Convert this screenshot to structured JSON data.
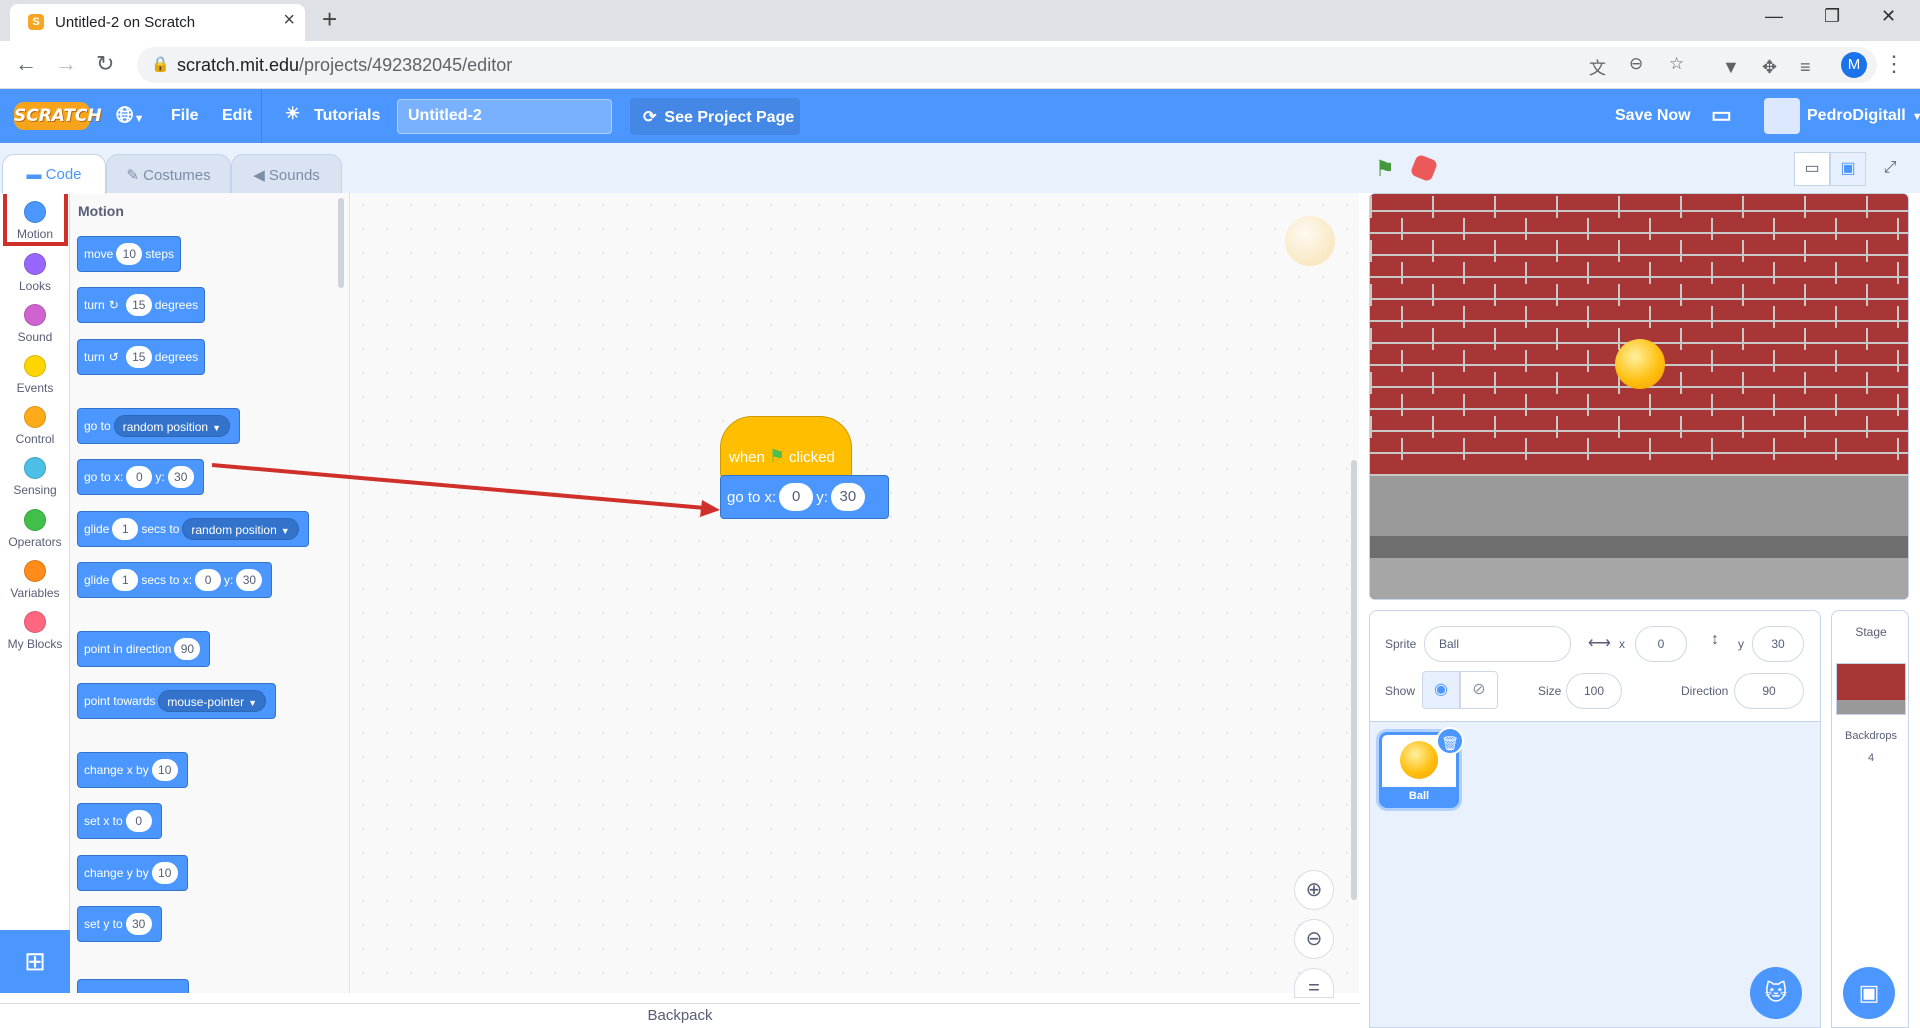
{
  "browser": {
    "tab_title": "Untitled-2 on Scratch",
    "tab_icon": "scratch-favicon",
    "url_host": "scratch.mit.edu",
    "url_path": "/projects/492382045/editor",
    "profile_initial": "M"
  },
  "menu": {
    "logo": "SCRATCH",
    "file": "File",
    "edit": "Edit",
    "tutorials": "Tutorials",
    "project_title": "Untitled-2",
    "see_project_page": "See Project Page",
    "save_now": "Save Now",
    "username": "PedroDigitall"
  },
  "editor_tabs": [
    "Code",
    "Costumes",
    "Sounds"
  ],
  "categories": [
    {
      "label": "Motion",
      "color": "#4c97ff"
    },
    {
      "label": "Looks",
      "color": "#9966ff"
    },
    {
      "label": "Sound",
      "color": "#cf63cf"
    },
    {
      "label": "Events",
      "color": "#ffd500"
    },
    {
      "label": "Control",
      "color": "#ffab19"
    },
    {
      "label": "Sensing",
      "color": "#4cbfe6"
    },
    {
      "label": "Operators",
      "color": "#40bf4a"
    },
    {
      "label": "Variables",
      "color": "#ff8c1a"
    },
    {
      "label": "My Blocks",
      "color": "#ff6680"
    }
  ],
  "palette": {
    "heading": "Motion",
    "blocks": {
      "move": {
        "a": "move",
        "v": "10",
        "b": "steps"
      },
      "turn_right": {
        "a": "turn",
        "v": "15",
        "b": "degrees"
      },
      "turn_left": {
        "a": "turn",
        "v": "15",
        "b": "degrees"
      },
      "goto": {
        "a": "go to",
        "d": "random position"
      },
      "goto_xy": {
        "a": "go to x:",
        "x": "0",
        "b": "y:",
        "y": "30"
      },
      "glide": {
        "a": "glide",
        "v": "1",
        "b": "secs to",
        "d": "random position"
      },
      "glide_xy": {
        "a": "glide",
        "v": "1",
        "b": "secs to x:",
        "x": "0",
        "c": "y:",
        "y": "30"
      },
      "point_dir": {
        "a": "point in direction",
        "v": "90"
      },
      "point_towards": {
        "a": "point towards",
        "d": "mouse-pointer"
      },
      "change_x": {
        "a": "change x by",
        "v": "10"
      },
      "set_x": {
        "a": "set x to",
        "v": "0"
      },
      "change_y": {
        "a": "change y by",
        "v": "10"
      },
      "set_y": {
        "a": "set y to",
        "v": "30"
      }
    }
  },
  "script": {
    "hat_when": "when",
    "hat_clicked": "clicked",
    "goto_label": "go to x:",
    "x": "0",
    "y_label": "y:",
    "y": "30"
  },
  "backpack": "Backpack",
  "sprite_info": {
    "sprite_label": "Sprite",
    "sprite_name": "Ball",
    "x_label": "x",
    "x": "0",
    "y_label": "y",
    "y": "30",
    "show_label": "Show",
    "size_label": "Size",
    "size": "100",
    "direction_label": "Direction",
    "direction": "90"
  },
  "sprites": [
    {
      "name": "Ball"
    }
  ],
  "stage_pane": {
    "heading": "Stage",
    "backdrops_label": "Backdrops",
    "backdrops_count": "4"
  },
  "colors": {
    "accent": "#4c97ff",
    "events": "#ffbf00",
    "highlight": "#d0302a"
  }
}
